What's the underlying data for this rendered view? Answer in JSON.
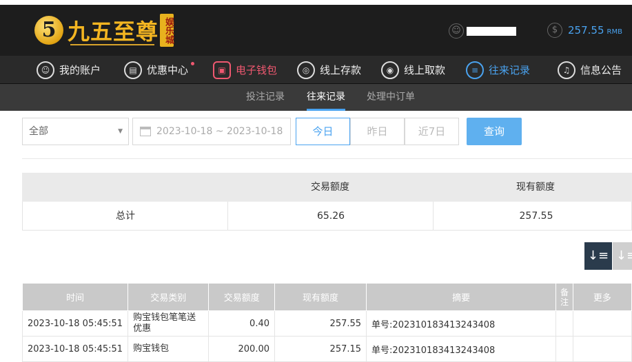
{
  "header": {
    "logo_mark": "5",
    "logo_text": "九五至尊",
    "logo_tag": "娱乐城",
    "balance": "257.55",
    "currency": "RMB",
    "user_icon": "user-icon",
    "money_icon": "dollar-icon"
  },
  "nav": {
    "items": [
      {
        "label": "我的账户",
        "icon": "user-icon"
      },
      {
        "label": "优惠中心",
        "icon": "gift-icon"
      },
      {
        "label": "电子钱包",
        "icon": "wallet-icon"
      },
      {
        "label": "线上存款",
        "icon": "deposit-icon"
      },
      {
        "label": "线上取款",
        "icon": "withdraw-icon"
      },
      {
        "label": "往来记录",
        "icon": "records-icon"
      },
      {
        "label": "信息公告",
        "icon": "bell-icon"
      }
    ],
    "colors": {
      "active_red": "#ef5870",
      "active_blue": "#4aa3f0"
    }
  },
  "subnav": {
    "tabs": [
      "投注记录",
      "往来记录",
      "处理中订单"
    ]
  },
  "filter": {
    "type_select": "全部",
    "date_range": "2023-10-18 ~ 2023-10-18",
    "quick": [
      "今日",
      "昨日",
      "近7日"
    ],
    "query": "查询"
  },
  "summary": {
    "headers": [
      "",
      "交易额度",
      "现有额度"
    ],
    "row": [
      "总计",
      "65.26",
      "257.55"
    ]
  },
  "records": {
    "headers": [
      "时间",
      "交易类别",
      "交易额度",
      "现有额度",
      "摘要",
      "备注",
      "更多"
    ],
    "rows": [
      [
        "2023-10-18 05:45:51",
        "购宝钱包笔笔送优惠",
        "0.40",
        "257.55",
        "单号:202310183413243408",
        "",
        ""
      ],
      [
        "2023-10-18 05:45:51",
        "购宝钱包",
        "200.00",
        "257.15",
        "单号:202310183413243408",
        "",
        ""
      ]
    ]
  }
}
